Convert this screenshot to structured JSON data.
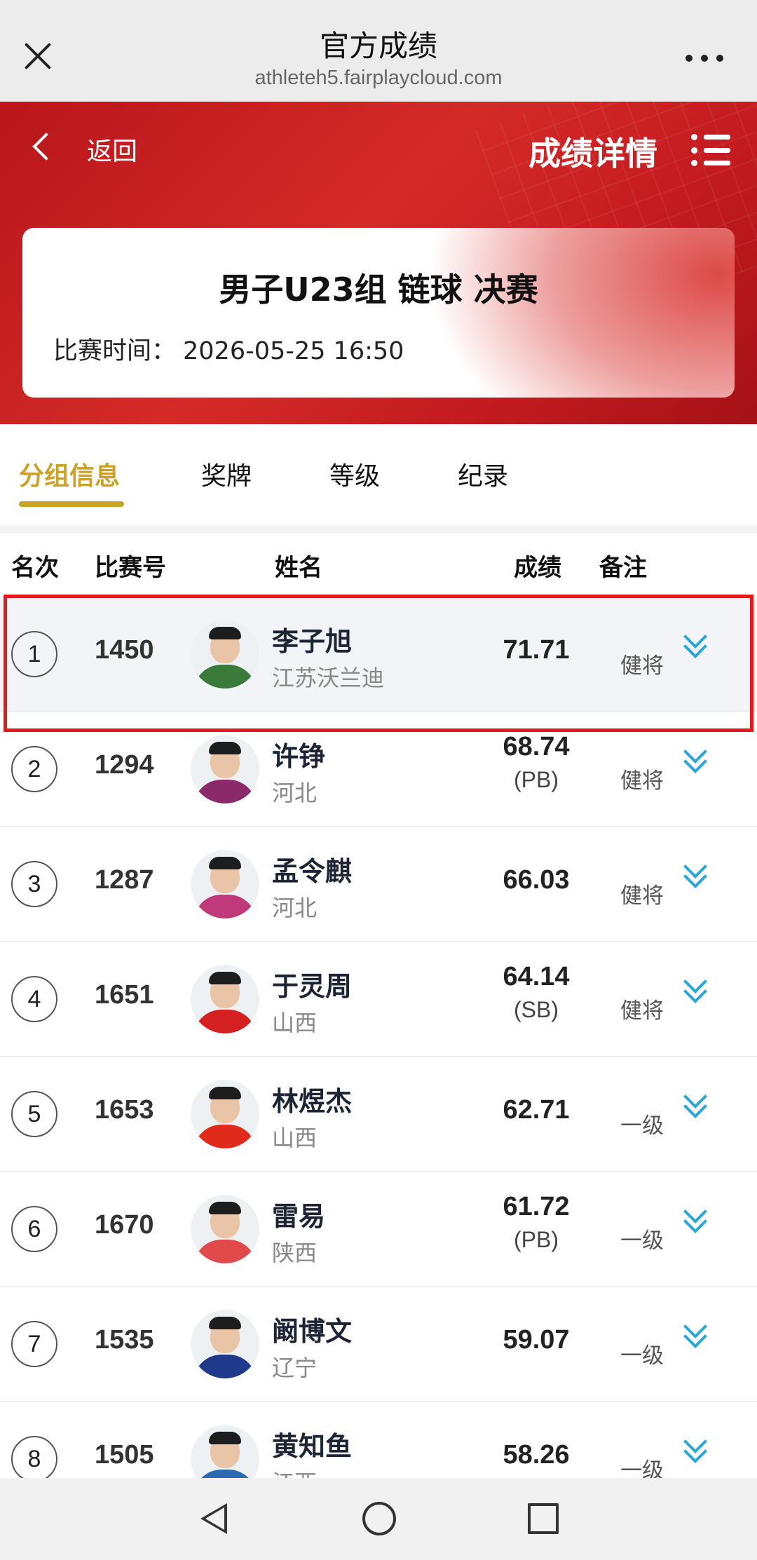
{
  "browser": {
    "title": "官方成绩",
    "url": "athleteh5.fairplaycloud.com"
  },
  "header": {
    "back_label": "返回",
    "title": "成绩详情"
  },
  "event": {
    "name": "男子U23组 链球 决赛",
    "time_label": "比赛时间：",
    "time_value": "2026-05-25  16:50"
  },
  "tabs": [
    {
      "label": "分组信息",
      "active": true
    },
    {
      "label": "奖牌",
      "active": false
    },
    {
      "label": "等级",
      "active": false
    },
    {
      "label": "纪录",
      "active": false
    }
  ],
  "columns": {
    "rank": "名次",
    "bib": "比赛号",
    "name": "姓名",
    "mark": "成绩",
    "remark": "备注"
  },
  "results": [
    {
      "rank": "1",
      "bib": "1450",
      "name": "李子旭",
      "team": "江苏沃兰迪",
      "mark": "71.71",
      "note": "",
      "remark": "健将",
      "shirt": "#3a7a3a"
    },
    {
      "rank": "2",
      "bib": "1294",
      "name": "许铮",
      "team": "河北",
      "mark": "68.74",
      "note": "(PB)",
      "remark": "健将",
      "shirt": "#8a2a6a"
    },
    {
      "rank": "3",
      "bib": "1287",
      "name": "孟令麒",
      "team": "河北",
      "mark": "66.03",
      "note": "",
      "remark": "健将",
      "shirt": "#c0397a"
    },
    {
      "rank": "4",
      "bib": "1651",
      "name": "于灵周",
      "team": "山西",
      "mark": "64.14",
      "note": "(SB)",
      "remark": "健将",
      "shirt": "#d42020"
    },
    {
      "rank": "5",
      "bib": "1653",
      "name": "林煜杰",
      "team": "山西",
      "mark": "62.71",
      "note": "",
      "remark": "一级",
      "shirt": "#e02a1a"
    },
    {
      "rank": "6",
      "bib": "1670",
      "name": "雷易",
      "team": "陕西",
      "mark": "61.72",
      "note": "(PB)",
      "remark": "一级",
      "shirt": "#e04a4a"
    },
    {
      "rank": "7",
      "bib": "1535",
      "name": "阚博文",
      "team": "辽宁",
      "mark": "59.07",
      "note": "",
      "remark": "一级",
      "shirt": "#1f3a8a"
    },
    {
      "rank": "8",
      "bib": "1505",
      "name": "黄知鱼",
      "team": "江西",
      "mark": "58.26",
      "note": "",
      "remark": "一级",
      "shirt": "#2a6ab0"
    }
  ]
}
